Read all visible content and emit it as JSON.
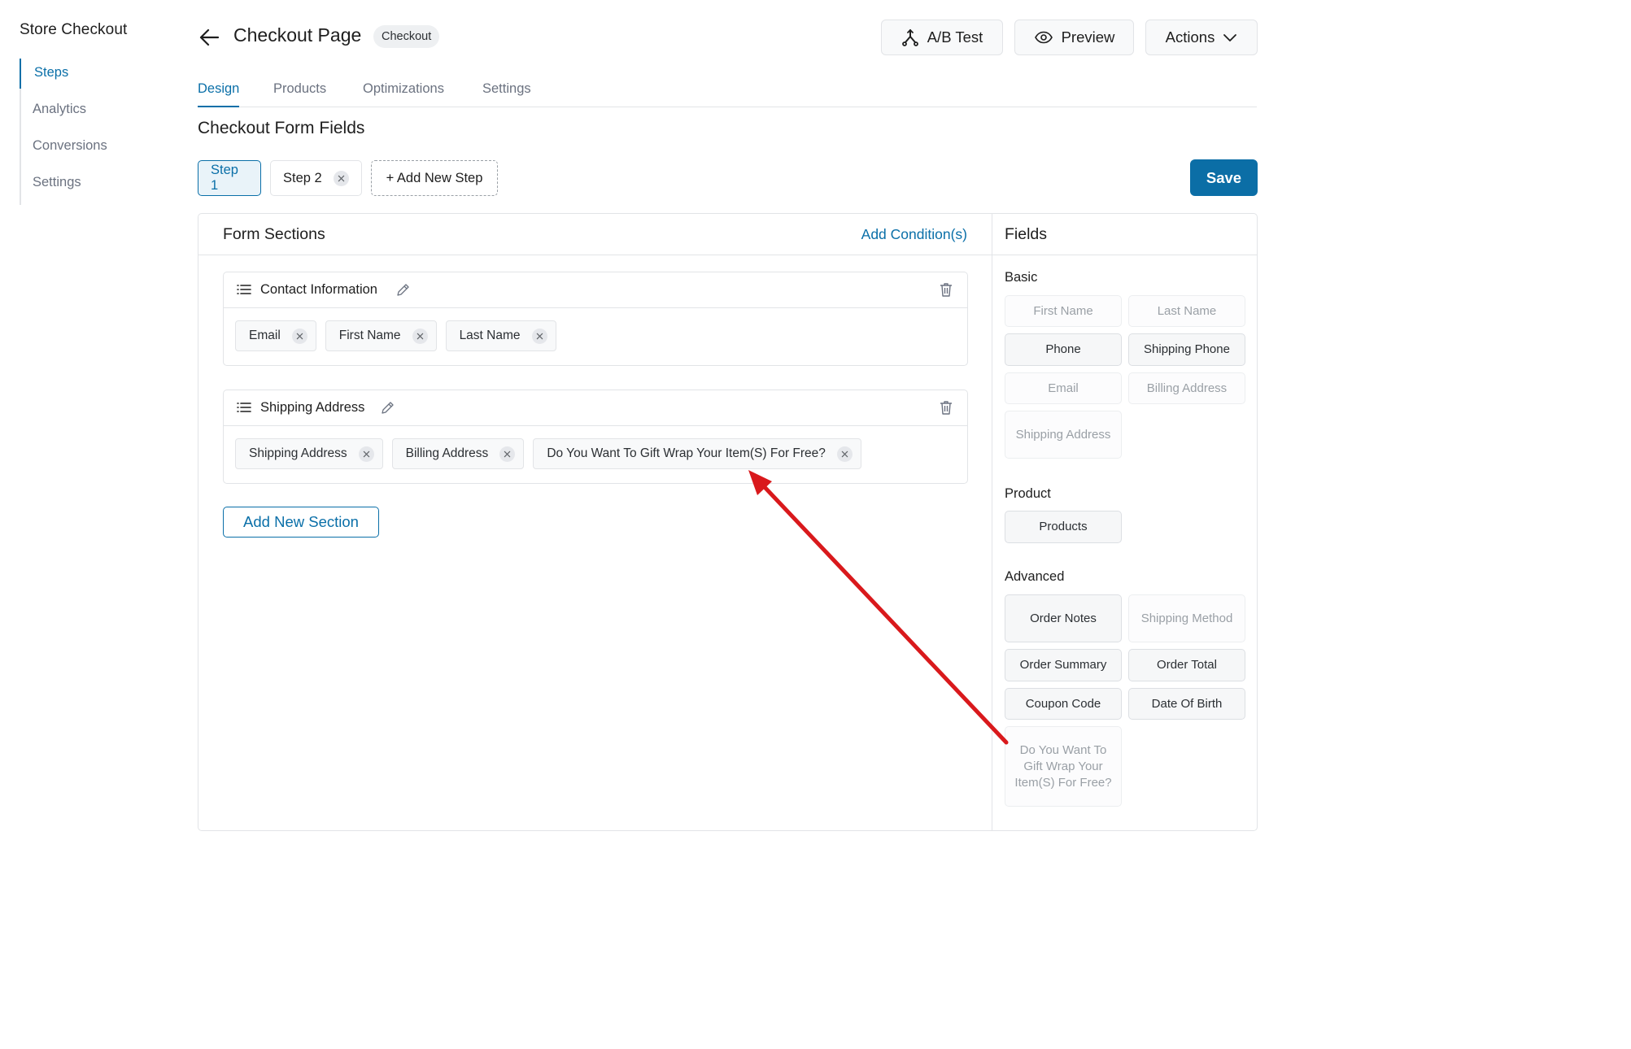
{
  "sidebar": {
    "title": "Store Checkout",
    "items": [
      {
        "label": "Steps",
        "active": true
      },
      {
        "label": "Analytics",
        "active": false
      },
      {
        "label": "Conversions",
        "active": false
      },
      {
        "label": "Settings",
        "active": false
      }
    ]
  },
  "header": {
    "title": "Checkout Page",
    "badge": "Checkout",
    "ab_test_label": "A/B Test",
    "preview_label": "Preview",
    "actions_label": "Actions"
  },
  "tabs": [
    {
      "label": "Design",
      "active": true
    },
    {
      "label": "Products",
      "active": false
    },
    {
      "label": "Optimizations",
      "active": false
    },
    {
      "label": "Settings",
      "active": false
    }
  ],
  "section_title": "Checkout Form Fields",
  "steps": {
    "step1": "Step 1",
    "step2": "Step 2",
    "add_new": "+ Add New Step"
  },
  "save_label": "Save",
  "form_sections": {
    "title": "Form Sections",
    "add_condition": "Add Condition(s)",
    "sections": [
      {
        "title": "Contact Information",
        "fields": [
          "Email",
          "First Name",
          "Last Name"
        ]
      },
      {
        "title": "Shipping Address",
        "fields": [
          "Shipping Address",
          "Billing Address",
          "Do You Want To Gift Wrap Your Item(S) For Free?"
        ]
      }
    ],
    "add_section": "Add New Section"
  },
  "fields_panel": {
    "title": "Fields",
    "groups": [
      {
        "label": "Basic",
        "items": [
          {
            "label": "First Name",
            "enabled": false
          },
          {
            "label": "Last Name",
            "enabled": false
          },
          {
            "label": "Phone",
            "enabled": true
          },
          {
            "label": "Shipping Phone",
            "enabled": true
          },
          {
            "label": "Email",
            "enabled": false
          },
          {
            "label": "Billing Address",
            "enabled": false
          },
          {
            "label": "Shipping Address",
            "enabled": false
          }
        ]
      },
      {
        "label": "Product",
        "items": [
          {
            "label": "Products",
            "enabled": true
          }
        ]
      },
      {
        "label": "Advanced",
        "items": [
          {
            "label": "Order Notes",
            "enabled": true
          },
          {
            "label": "Shipping Method",
            "enabled": false
          },
          {
            "label": "Order Summary",
            "enabled": true
          },
          {
            "label": "Order Total",
            "enabled": true
          },
          {
            "label": "Coupon Code",
            "enabled": true
          },
          {
            "label": "Date Of Birth",
            "enabled": true
          },
          {
            "label": "Do You Want To Gift Wrap Your Item(S) For Free?",
            "enabled": false
          }
        ]
      }
    ]
  },
  "colors": {
    "accent": "#0a6fa8",
    "annotation_arrow": "#d9191c"
  },
  "icons": [
    "back-arrow-icon",
    "ab-test-icon",
    "eye-icon",
    "chevron-down-icon",
    "close-icon",
    "list-icon",
    "pencil-icon",
    "trash-icon"
  ]
}
